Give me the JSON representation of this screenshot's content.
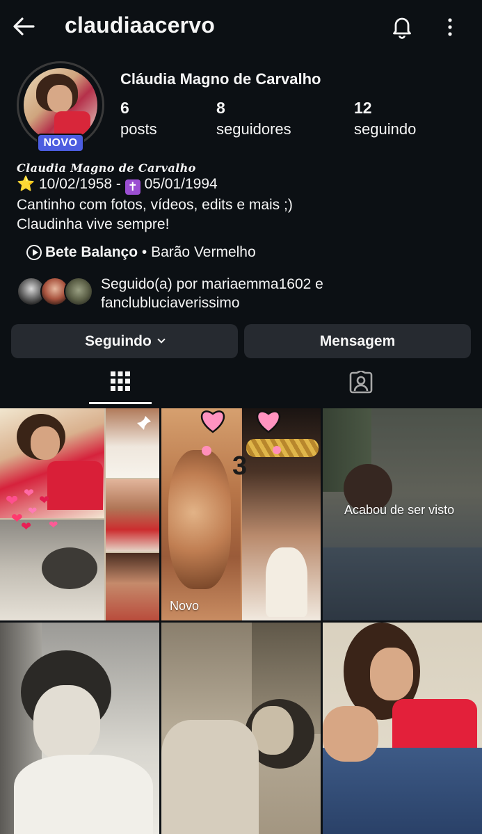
{
  "header": {
    "username": "claudiaacervo",
    "back_icon": "arrow-left-icon",
    "bell_icon": "bell-icon",
    "more_icon": "more-vertical-icon"
  },
  "profile": {
    "badge": "NOVO",
    "full_name": "Cláudia Magno de Carvalho",
    "stats": [
      {
        "value": "6",
        "label": "posts"
      },
      {
        "value": "8",
        "label": "seguidores"
      },
      {
        "value": "12",
        "label": "seguindo"
      }
    ]
  },
  "bio": {
    "title": "Claudia Magno de Carvalho",
    "birth": "10/02/1958 - ",
    "death": "05/01/1994",
    "line2": "Cantinho com fotos, vídeos, edits e mais ;)",
    "line3": "Claudinha vive sempre!",
    "star_glyph": "⭐",
    "cross_glyph": "✝"
  },
  "music": {
    "song": "Bete Balanço",
    "separator": " • ",
    "artist": "Barão Vermelho"
  },
  "mutual": {
    "line1": "Seguido(a) por mariaemma1602 e",
    "line2": "fanclubluciaverissimo"
  },
  "actions": {
    "following_label": "Seguindo",
    "message_label": "Mensagem"
  },
  "tabs": {
    "grid_icon": "grid-icon",
    "tagged_icon": "tagged-person-icon"
  },
  "posts": {
    "p2_label": "Novo",
    "p2_number": "3",
    "p3_label": "Acabou de ser visto"
  },
  "colors": {
    "background": "#0c1014",
    "button": "#262a30",
    "badge": "#4c5de0",
    "accent_red": "#d8263a"
  }
}
